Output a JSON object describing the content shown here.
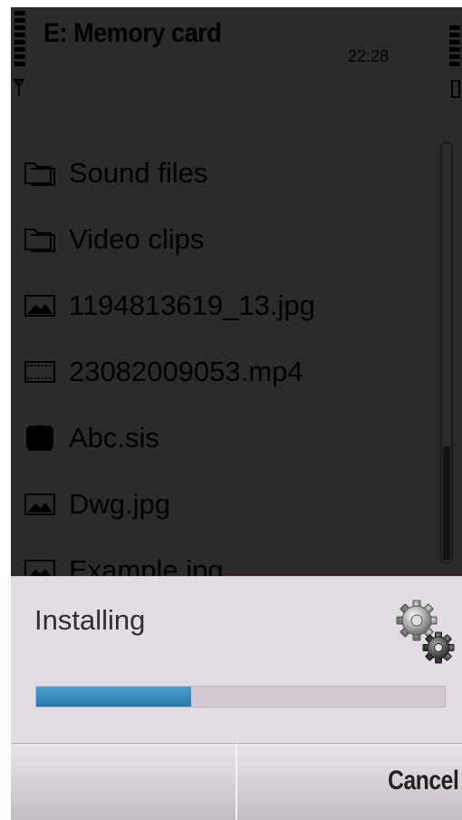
{
  "status_bar": {
    "title": "E: Memory card",
    "time": "22:28"
  },
  "files": [
    {
      "label": "Sound files",
      "icon": "folder-icon"
    },
    {
      "label": "Video clips",
      "icon": "folder-icon"
    },
    {
      "label": "1194813619_13.jpg",
      "icon": "image-icon"
    },
    {
      "label": "23082009053.mp4",
      "icon": "video-icon"
    },
    {
      "label": "Abc.sis",
      "icon": "app-icon"
    },
    {
      "label": "Dwg.jpg",
      "icon": "image-icon"
    },
    {
      "label": "Example.jpg",
      "icon": "image-icon"
    }
  ],
  "dialog": {
    "title": "Installing",
    "progress": 0.38,
    "icon": "gears-icon"
  },
  "softkeys": {
    "left_label": "",
    "right_label": "Cancel"
  },
  "colors": {
    "progress_fill": "#3a8bbf",
    "dialog_bg": "#e2dce3",
    "dim_overlay": "#2b2b2b"
  }
}
